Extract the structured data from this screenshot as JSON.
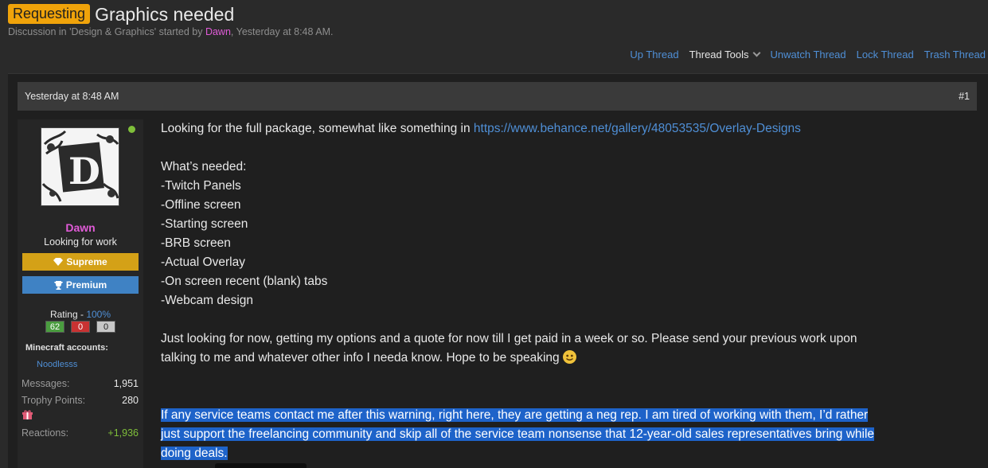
{
  "thread": {
    "prefix": "Requesting",
    "title": "Graphics needed",
    "meta_prefix": "Discussion in 'Design & Graphics' started by ",
    "author": "Dawn",
    "meta_suffix": ", Yesterday at 8:48 AM."
  },
  "tools": {
    "up_thread": "Up Thread",
    "thread_tools": "Thread Tools",
    "unwatch": "Unwatch Thread",
    "lock": "Lock Thread",
    "trash": "Trash Thread"
  },
  "post": {
    "timestamp": "Yesterday at 8:48 AM",
    "number": "#1",
    "intro": "Looking for the full package, somewhat like something in ",
    "url": "https://www.behance.net/gallery/48053535/Overlay-Designs",
    "needed_heading": "What’s needed:",
    "items": [
      "-Twitch Panels",
      "-Offline screen",
      "-Starting screen",
      "-BRB screen",
      "-Actual Overlay",
      "-On screen recent (blank) tabs",
      "-Webcam design"
    ],
    "closing_line1": "Just looking for now, getting my options and a quote for now till I get paid in a week or so. Please send your previous work upon",
    "closing_line2": "talking to me and whatever other info I needa know. Hope to be speaking ",
    "warning_line1": "If any service teams contact me after this warning, right here, they are getting a neg rep. I am tired of working with them, I’d rather",
    "warning_line2": "just support the freelancing community and skip all of the service team nonsense that 12-year-old sales representatives bring while",
    "warning_line3": "doing deals."
  },
  "user": {
    "name": "Dawn",
    "title": "Looking for work",
    "banner_supreme": "Supreme",
    "banner_premium": "Premium",
    "rating_label": "Rating - ",
    "rating_pct": "100%",
    "rating_positive": "62",
    "rating_negative": "0",
    "rating_neutral": "0",
    "minecraft_label": "Minecraft accounts:",
    "minecraft_account": "Noodlesss",
    "messages_label": "Messages:",
    "messages": "1,951",
    "trophy_label": "Trophy Points:",
    "trophy": "280",
    "reactions_label": "Reactions:",
    "reactions": "+1,936",
    "avatar_letter": "D"
  },
  "colors": {
    "prefix_badge": "#f0a30a",
    "username": "#e15bd8",
    "link": "#4f8fd6",
    "supreme": "#d4a117",
    "premium": "#3f82c4",
    "online": "#7fbf3a",
    "selection": "#1e63c9"
  },
  "icons": [
    "chevron-down-icon",
    "diamond-icon",
    "trophy-icon",
    "gift-icon",
    "smiley-icon",
    "online-status-icon"
  ]
}
